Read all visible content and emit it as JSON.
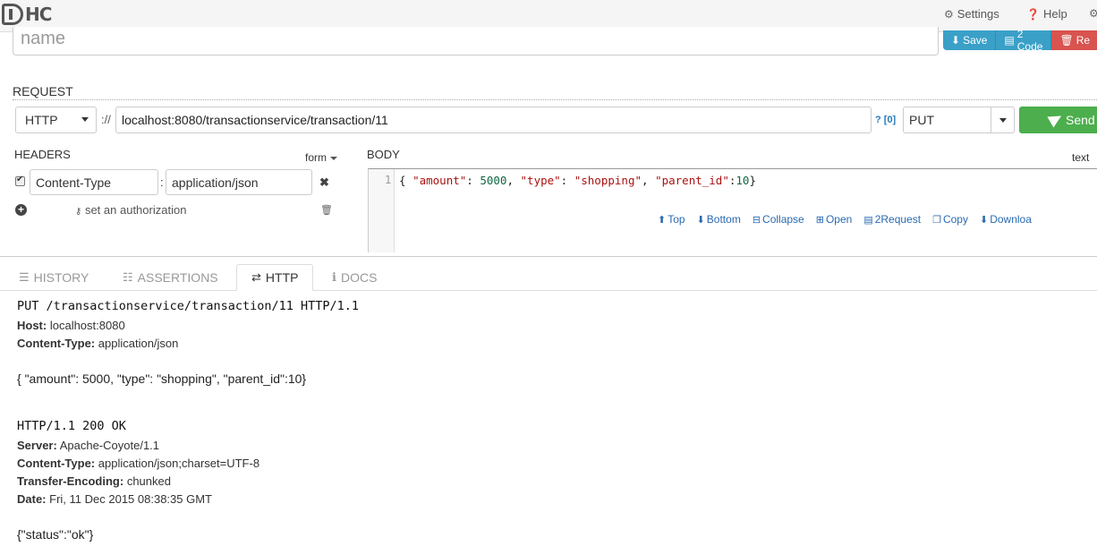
{
  "app": {
    "logo_text": "HC"
  },
  "topnav": {
    "settings": "Settings",
    "help": "Help"
  },
  "name_field": {
    "placeholder": "name"
  },
  "toolbar": {
    "save": "Save",
    "code": "2 Code",
    "remove": "Re"
  },
  "request": {
    "label": "REQUEST",
    "scheme": "HTTP",
    "separator": "://",
    "url": "localhost:8080/transactionservice/transaction/11",
    "query_count": "? [0]",
    "method": "PUT",
    "send": "Send"
  },
  "headers": {
    "label": "HEADERS",
    "mode": "form",
    "rows": [
      {
        "name": "Content-Type",
        "value": "application/json",
        "enabled": true
      }
    ],
    "auth": "set an authorization"
  },
  "body": {
    "label": "BODY",
    "mode": "text",
    "line_no": "1",
    "content": "{ \"amount\": 5000, \"type\": \"shopping\", \"parent_id\":10}",
    "tools": [
      "Top",
      "Bottom",
      "Collapse",
      "Open",
      "2Request",
      "Copy",
      "Downloa"
    ]
  },
  "tabs": [
    {
      "label": "HISTORY",
      "icon": "list-icon"
    },
    {
      "label": "ASSERTIONS",
      "icon": "assertions-icon"
    },
    {
      "label": "HTTP",
      "icon": "exchange-icon"
    },
    {
      "label": "DOCS",
      "icon": "info-icon"
    }
  ],
  "active_tab": "HTTP",
  "http": {
    "request_line": "PUT /transactionservice/transaction/11 HTTP/1.1",
    "request_headers": [
      {
        "k": "Host:",
        "v": "localhost:8080"
      },
      {
        "k": "Content-Type:",
        "v": "application/json"
      }
    ],
    "request_body": "{ \"amount\": 5000, \"type\": \"shopping\", \"parent_id\":10}",
    "status_line": "HTTP/1.1 200 OK",
    "response_headers": [
      {
        "k": "Server:",
        "v": "Apache-Coyote/1.1"
      },
      {
        "k": "Content-Type:",
        "v": "application/json;charset=UTF-8"
      },
      {
        "k": "Transfer-Encoding:",
        "v": "chunked"
      },
      {
        "k": "Date:",
        "v": "Fri, 11 Dec 2015 08:38:35 GMT"
      }
    ],
    "response_body": "{\"status\":\"ok\"}"
  }
}
